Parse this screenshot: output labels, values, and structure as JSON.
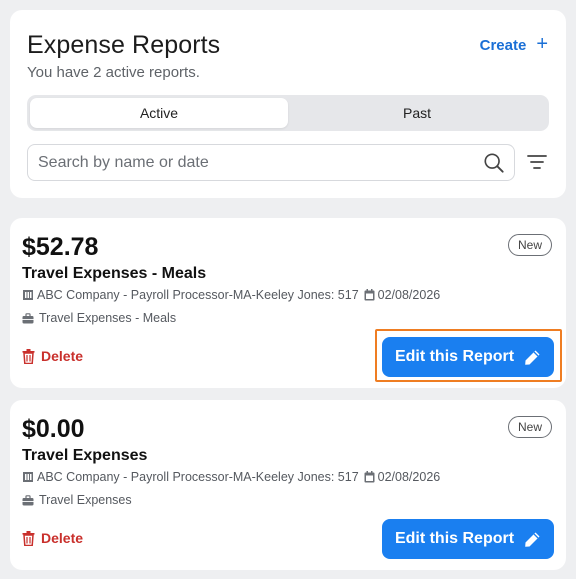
{
  "header": {
    "title": "Expense Reports",
    "subtitle": "You have 2 active reports.",
    "create_label": "Create",
    "create_icon": "+"
  },
  "tabs": [
    {
      "label": "Active",
      "selected": true
    },
    {
      "label": "Past",
      "selected": false
    }
  ],
  "search": {
    "placeholder": "Search by name or date",
    "value": ""
  },
  "reports": [
    {
      "amount": "$52.78",
      "badge": "New",
      "title": "Travel Expenses - Meals",
      "company": "ABC Company - Payroll Processor-MA-Keeley Jones: 517",
      "date": "02/08/2026",
      "category": "Travel Expenses - Meals",
      "delete_label": "Delete",
      "edit_label": "Edit this Report",
      "focused": true
    },
    {
      "amount": "$0.00",
      "badge": "New",
      "title": "Travel Expenses",
      "company": "ABC Company - Payroll Processor-MA-Keeley Jones: 517",
      "date": "02/08/2026",
      "category": "Travel Expenses",
      "delete_label": "Delete",
      "edit_label": "Edit this Report",
      "focused": false
    }
  ],
  "colors": {
    "accent": "#1a7ff0",
    "link": "#1a6fd6",
    "danger": "#c9302c",
    "focus": "#ef7d22",
    "background": "#eeeff1"
  },
  "icons": {
    "create": "plus-icon",
    "search": "search-icon",
    "filter": "filter-icon",
    "company": "building-icon",
    "date": "calendar-icon",
    "category": "briefcase-icon",
    "delete": "trash-icon",
    "edit": "pencil-icon"
  }
}
